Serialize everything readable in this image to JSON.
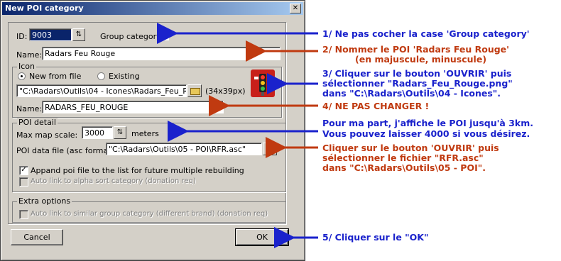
{
  "dialog": {
    "title": "New POI category",
    "close_glyph": "✕",
    "id_label": "ID:",
    "id_value": "9003",
    "group_category_label": "Group category",
    "name_label": "Name:",
    "name_value": "Radars Feu Rouge",
    "icon_group_title": "Icon",
    "new_from_file_label": "New from file",
    "existing_label": "Existing",
    "icon_path": "\"C:\\Radars\\Outils\\04 - Icones\\Radars_Feu_Rouge.png\"",
    "icon_size": "(34x39px)",
    "icon_name_label": "Name:",
    "icon_name_value": "RADARS_FEU_ROUGE",
    "poi_detail_title": "POI detail",
    "max_scale_label": "Max map scale:",
    "max_scale_value": "3000",
    "meters_label": "meters",
    "poi_file_label": "POI data file (asc format):",
    "poi_file_value": "\"C:\\Radars\\Outils\\05 - POI\\RFR.asc\"",
    "append_label": "Appand poi file to the list for future multiple rebuilding",
    "auto_link_alpha_label": "Auto link to alpha sort category (donation req)",
    "extra_options_title": "Extra options",
    "auto_link_similar_label": "Auto link to similar group category (different brand) (donation req)",
    "cancel_label": "Cancel",
    "ok_label": "OK",
    "checked_glyph": "✓",
    "spin_glyph": "⇅"
  },
  "annotations": {
    "a1": "1/ Ne pas cocher la case 'Group category'",
    "a2_line1": "2/ Nommer le POI 'Radars Feu Rouge'",
    "a2_line2": "(en majuscule, minuscule)",
    "a3_line1": "3/ Cliquer sur le bouton 'OUVRIR' puis",
    "a3_line2": "sélectionner \"Radars_Feu_Rouge.png\"",
    "a3_line3": "dans \"C:\\Radars\\Outils\\04 - Icones\".",
    "a4": "4/ NE PAS CHANGER !",
    "a5_line1": "Pour ma part, j'affiche le POI jusqu'à 3km.",
    "a5_line2": "Vous pouvez laisser 4000 si vous désirez.",
    "a6_line1": "Cliquer sur le bouton 'OUVRIR' puis",
    "a6_line2": "sélectionner le fichier \"RFR.asc\"",
    "a6_line3": "dans \"C:\\Radars\\Outils\\05 - POI\".",
    "a7": "5/ Cliquer sur le \"OK\""
  },
  "colors": {
    "blue_annotation": "#1a22cc",
    "red_annotation": "#c03a10",
    "title_bar": "#0a246a"
  }
}
